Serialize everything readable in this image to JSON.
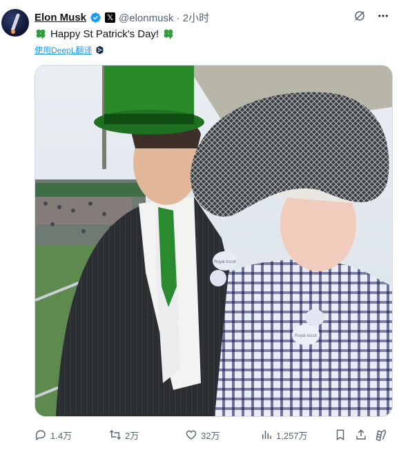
{
  "tweet": {
    "author_name": "Elon Musk",
    "x_badge": "𝕏",
    "handle_time": "@elonmusk · 2小时",
    "text": "Happy St Patrick's Day!",
    "translate_label": "使用DeepL翻译"
  },
  "photo": {
    "badge_left_1": "Royal Ascot",
    "badge_right_1": "Royal Ascot"
  },
  "actions": {
    "replies": "1.4万",
    "reposts": "2万",
    "likes": "32万",
    "views": "1,257万"
  },
  "colors": {
    "accent": "#1d9bf0",
    "text": "#0f1419",
    "muted": "#536471",
    "clover": "#2e9e3a"
  },
  "icons": [
    "avatar",
    "verified-icon",
    "x-badge",
    "grok-icon",
    "more-icon",
    "clover-icon",
    "deepl-icon",
    "reply-icon",
    "repost-icon",
    "like-icon",
    "views-icon",
    "bookmark-icon",
    "share-icon",
    "extension-icon"
  ]
}
